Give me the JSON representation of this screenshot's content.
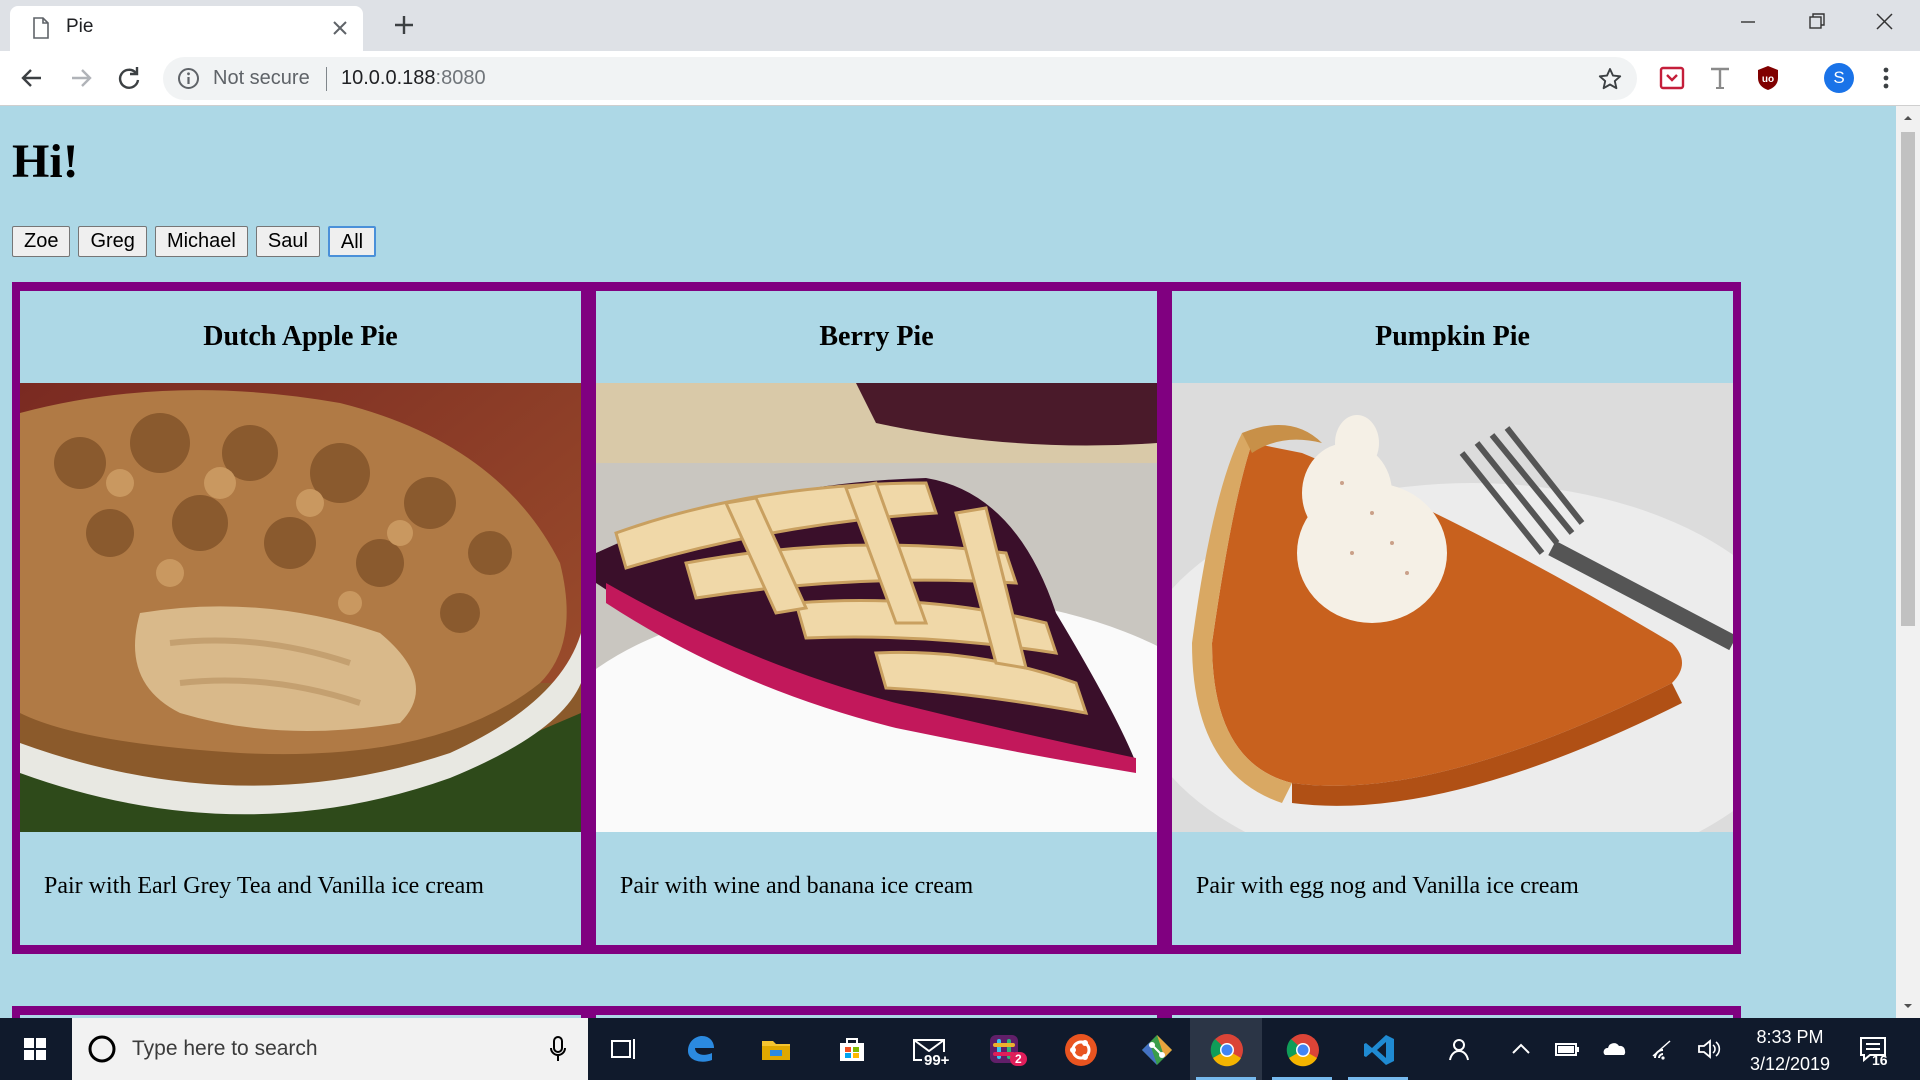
{
  "browser": {
    "tab_title": "Pie",
    "security_label": "Not secure",
    "url_host": "10.0.0.188",
    "url_port": ":8080",
    "profile_initial": "S"
  },
  "page": {
    "title": "Hi!",
    "filters": [
      "Zoe",
      "Greg",
      "Michael",
      "Saul",
      "All"
    ],
    "active_filter": "All",
    "pies": [
      {
        "name": "Dutch Apple Pie",
        "description": "Pair with Earl Grey Tea and Vanilla ice cream",
        "image": "dutch-apple-pie-photo"
      },
      {
        "name": "Berry Pie",
        "description": "Pair with wine and banana ice cream",
        "image": "berry-pie-photo"
      },
      {
        "name": "Pumpkin Pie",
        "description": "Pair with egg nog and Vanilla ice cream",
        "image": "pumpkin-pie-photo"
      }
    ],
    "colors": {
      "background": "#add8e6",
      "card_border": "#800080"
    }
  },
  "taskbar": {
    "search_placeholder": "Type here to search",
    "mail_badge": "99+",
    "slack_badge": "2",
    "time": "8:33 PM",
    "date": "3/12/2019",
    "notification_count": "16",
    "apps": [
      "task-view-icon",
      "edge-icon",
      "file-explorer-icon",
      "store-icon",
      "mail-icon",
      "slack-icon",
      "ubuntu-icon",
      "git-icon",
      "chrome-icon",
      "chrome-icon",
      "vscode-icon"
    ]
  }
}
